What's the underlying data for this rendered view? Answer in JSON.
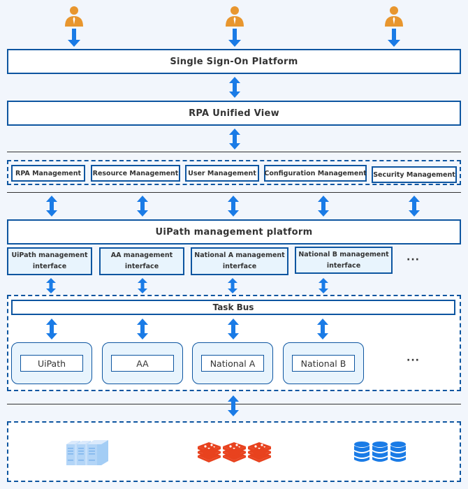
{
  "users": [
    {
      "icon": "user-icon"
    },
    {
      "icon": "user-icon"
    },
    {
      "icon": "user-icon"
    }
  ],
  "layers": {
    "sso": "Single Sign-On Platform",
    "unified_view": "RPA Unified View",
    "management_modules": [
      "RPA Management",
      "Resource Management",
      "User Management",
      "Configuration Management",
      "Security Management"
    ],
    "management_platform": "UiPath management platform",
    "interfaces": [
      {
        "line1": "UiPath management",
        "line2": "interface"
      },
      {
        "line1": "AA management",
        "line2": "interface"
      },
      {
        "line1": "National A management",
        "line2": "interface"
      },
      {
        "line1": "National B management",
        "line2": "interface"
      }
    ],
    "interfaces_more": "···",
    "task_bus": "Task Bus",
    "engines": [
      "UiPath",
      "AA",
      "National A",
      "National B"
    ],
    "engines_more": "···",
    "infrastructure": [
      {
        "icon": "server-cluster-icon"
      },
      {
        "icon": "redis-cache-icon"
      },
      {
        "icon": "database-icon"
      }
    ]
  },
  "colors": {
    "border": "#0d55a0",
    "arrow": "#1a7be6",
    "user": "#e8962e",
    "redis": "#e8421e",
    "server": "#a3cdf5",
    "background": "#f2f6fc"
  }
}
